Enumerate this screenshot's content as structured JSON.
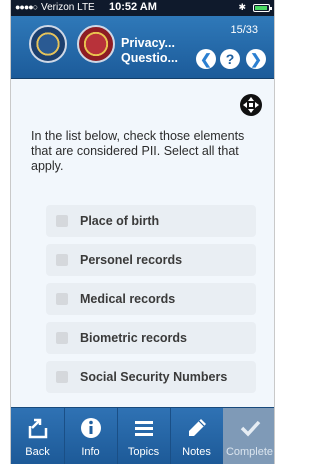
{
  "status_bar": {
    "signal": "●●●●○",
    "carrier": "Verizon  LTE",
    "time": "10:52 AM",
    "bluetooth": "✱"
  },
  "header": {
    "title_line1": "Privacy...",
    "title_line2": "Questio...",
    "counter": "15/33",
    "prev_glyph": "❮",
    "help_glyph": "?",
    "next_glyph": "❯"
  },
  "question": {
    "prompt": "In the list below, check those elements that are considered PII. Select all that apply.",
    "options": [
      {
        "label": "Place of birth",
        "checked": false
      },
      {
        "label": "Personel records",
        "checked": false
      },
      {
        "label": "Medical records",
        "checked": false
      },
      {
        "label": "Biometric records",
        "checked": false
      },
      {
        "label": "Social Security Numbers",
        "checked": false
      }
    ]
  },
  "tabbar": {
    "back": "Back",
    "info": "Info",
    "topics": "Topics",
    "notes": "Notes",
    "complete": "Complete"
  },
  "colors": {
    "header_blue": "#2f79b9",
    "tab_blue": "#2f72b4",
    "complete_disabled": "#7f9ab7",
    "battery_green": "#4cd964"
  }
}
